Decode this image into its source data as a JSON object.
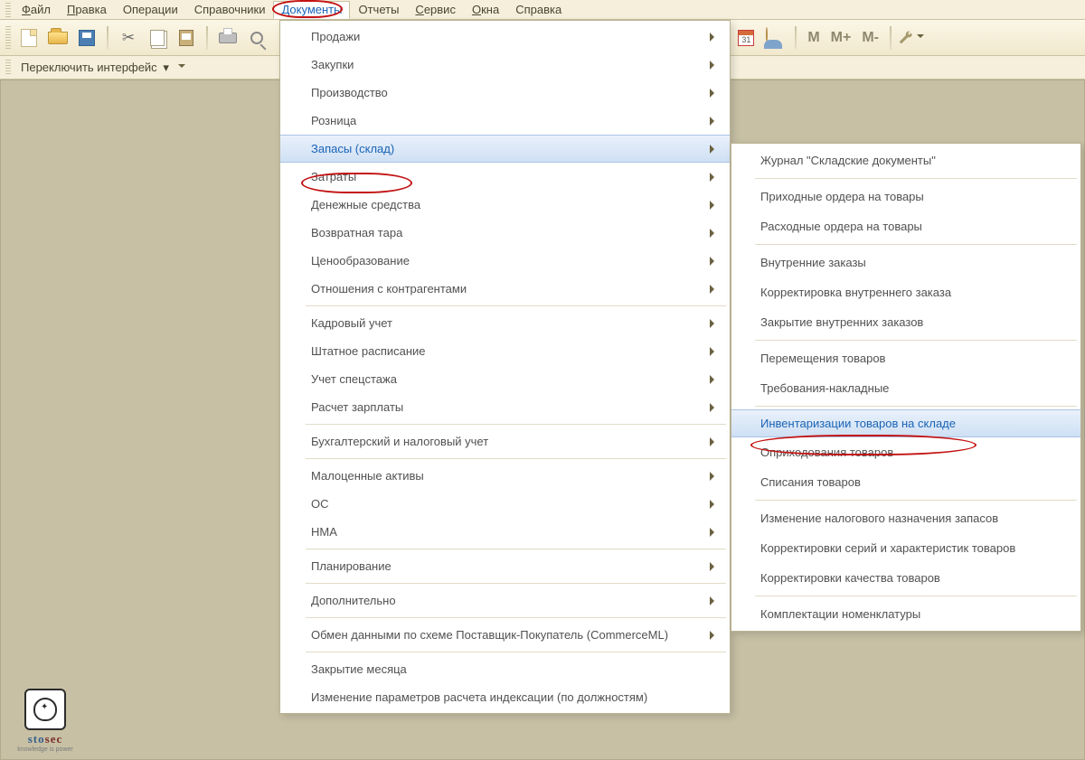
{
  "menubar": {
    "items": [
      {
        "mn": "Ф",
        "label": "айл"
      },
      {
        "mn": "П",
        "label": "равка"
      },
      {
        "mn": "",
        "label": "Операции"
      },
      {
        "mn": "",
        "label": "Справочники"
      },
      {
        "mn": "Д",
        "label": "окументы"
      },
      {
        "mn": "",
        "label": "Отчеты"
      },
      {
        "mn": "С",
        "label": "ервис"
      },
      {
        "mn": "О",
        "label": "кна"
      },
      {
        "mn": "",
        "label": "Справка"
      }
    ]
  },
  "toolbar": {
    "m": "М",
    "m_plus": "М+",
    "m_minus": "М-"
  },
  "substrip": {
    "switch_label": "Переключить интерфейс"
  },
  "main_menu": {
    "groups": [
      [
        "Продажи",
        "Закупки",
        "Производство",
        "Розница",
        "Запасы (склад)",
        "Затраты",
        "Денежные средства",
        "Возвратная тара",
        "Ценообразование",
        "Отношения с контрагентами"
      ],
      [
        "Кадровый учет",
        "Штатное расписание",
        "Учет спецстажа",
        "Расчет зарплаты"
      ],
      [
        "Бухгалтерский и налоговый учет"
      ],
      [
        "Малоценные активы",
        "ОС",
        "НМА"
      ],
      [
        "Планирование"
      ],
      [
        "Дополнительно"
      ],
      [
        "Обмен данными по схеме Поставщик-Покупатель (CommerceML)"
      ],
      [
        "Закрытие месяца",
        "Изменение параметров расчета индексации (по должностям)"
      ]
    ],
    "highlight": "Запасы (склад)",
    "no_arrow": [
      "Закрытие месяца",
      "Изменение параметров расчета индексации (по должностям)"
    ]
  },
  "sub_menu": {
    "groups": [
      [
        "Журнал \"Складские документы\""
      ],
      [
        "Приходные ордера на товары",
        "Расходные ордера на товары"
      ],
      [
        "Внутренние заказы",
        "Корректировка внутреннего заказа",
        "Закрытие внутренних заказов"
      ],
      [
        "Перемещения товаров",
        "Требования-накладные"
      ],
      [
        "Инвентаризации товаров на складе",
        "Оприходования товаров",
        "Списания товаров"
      ],
      [
        "Изменение налогового назначения запасов",
        "Корректировки серий и характеристик товаров",
        "Корректировки качества товаров"
      ],
      [
        "Комплектации номенклатуры"
      ]
    ],
    "highlight": "Инвентаризации товаров на складе"
  },
  "logo": {
    "line1": "sto",
    "line2": "sec",
    "tagline": "knowledge is power"
  }
}
